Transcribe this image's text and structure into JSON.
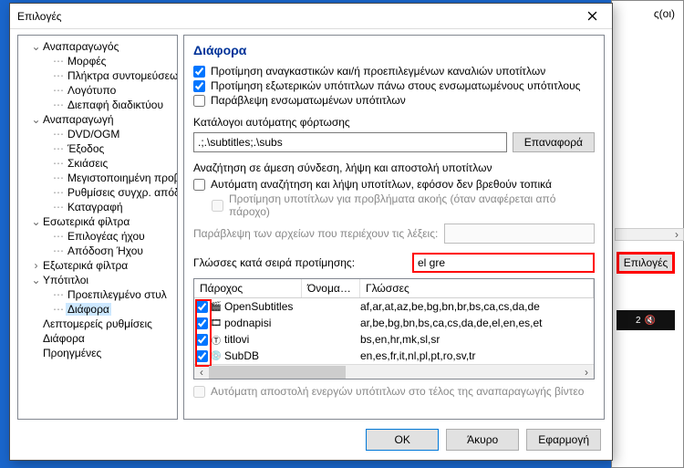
{
  "bg": {
    "headerSuffix": "ς(οι)",
    "optionsBtn": "Επιλογές",
    "dark1": "2",
    "darkIcon": "🔇"
  },
  "dialog": {
    "title": "Επιλογές"
  },
  "tree": [
    {
      "lvl": 1,
      "exp": "⌄",
      "label": "Αναπαραγωγός"
    },
    {
      "lvl": 2,
      "label": "Μορφές"
    },
    {
      "lvl": 2,
      "label": "Πλήκτρα συντομεύσεων"
    },
    {
      "lvl": 2,
      "label": "Λογότυπο"
    },
    {
      "lvl": 2,
      "label": "Διεπαφή διαδικτύου"
    },
    {
      "lvl": 1,
      "exp": "⌄",
      "label": "Αναπαραγωγή"
    },
    {
      "lvl": 2,
      "label": "DVD/OGM"
    },
    {
      "lvl": 2,
      "label": "Έξοδος"
    },
    {
      "lvl": 2,
      "label": "Σκιάσεις"
    },
    {
      "lvl": 2,
      "label": "Μεγιστοποιημένη προβ"
    },
    {
      "lvl": 2,
      "label": "Ρυθμίσεις συγχρ. απόδο"
    },
    {
      "lvl": 2,
      "label": "Καταγραφή"
    },
    {
      "lvl": 1,
      "exp": "⌄",
      "label": "Εσωτερικά φίλτρα"
    },
    {
      "lvl": 2,
      "label": "Επιλογέας ήχου"
    },
    {
      "lvl": 2,
      "label": "Απόδοση Ήχου"
    },
    {
      "lvl": 1,
      "exp": ">",
      "label": "Εξωτερικά φίλτρα"
    },
    {
      "lvl": 1,
      "exp": "⌄",
      "label": "Υπότιτλοι"
    },
    {
      "lvl": 2,
      "label": "Προεπιλεγμένο στυλ"
    },
    {
      "lvl": 2,
      "label": "Διάφορα",
      "sel": true
    },
    {
      "lvl": 1,
      "label": "Λεπτομερείς ρυθμίσεις"
    },
    {
      "lvl": 1,
      "label": "Διάφορα"
    },
    {
      "lvl": 1,
      "label": "Προηγμένες"
    }
  ],
  "content": {
    "heading": "Διάφορα",
    "preferForced": "Προτίμηση αναγκαστικών και/ή προεπιλεγμένων καναλιών υποτίτλων",
    "preferExternal": "Προτίμηση εξωτερικών υπότιτλων πάνω στους ενσωματωμένους υπότιτλους",
    "ignoreEmbedded": "Παράβλεψη ενσωματωμένων υπότιτλων",
    "autoloadLabel": "Κατάλογοι αυτόματης φόρτωσης",
    "autoloadPaths": ".;.\\subtitles;.\\subs",
    "resetBtn": "Επαναφορά",
    "onlineLabel": "Αναζήτηση σε άμεση σύνδεση, λήψη και αποστολή υποτίτλων",
    "autoSearch": "Αυτόματη αναζήτηση και λήψη υποτίτλων, εφόσον δεν βρεθούν τοπικά",
    "preferHearing": "Προτίμηση υποτίτλων για προβλήματα ακοής (όταν αναφέρεται από πάροχο)",
    "ignoreWordsLabel": "Παράβλεψη των αρχείων που περιέχουν τις λέξεις:",
    "ignoreWordsValue": "",
    "languagesLabel": "Γλώσσες κατά σειρά προτίμησης:",
    "languagesValue": "el gre",
    "tableHeaders": {
      "provider": "Πάροχος",
      "user": "Όνομα χρ...",
      "langs": "Γλώσσες"
    },
    "providers": [
      {
        "checked": true,
        "icon": "movie",
        "name": "OpenSubtitles",
        "langs": "af,ar,at,az,be,bg,bn,br,bs,ca,cs,da,de"
      },
      {
        "checked": true,
        "icon": "film",
        "name": "podnapisi",
        "langs": "ar,be,bg,bn,bs,ca,cs,da,de,el,en,es,et"
      },
      {
        "checked": true,
        "icon": "t",
        "name": "titlovi",
        "langs": "bs,en,hr,mk,sl,sr"
      },
      {
        "checked": true,
        "icon": "disc",
        "name": "SubDB",
        "langs": "en,es,fr,it,nl,pl,pt,ro,sv,tr"
      }
    ],
    "autoUpload": "Αυτόματη αποστολή ενεργών υπότιτλων στο τέλος της αναπαραγωγής βίντεο"
  },
  "footer": {
    "ok": "OK",
    "cancel": "Άκυρο",
    "apply": "Εφαρμογή"
  }
}
